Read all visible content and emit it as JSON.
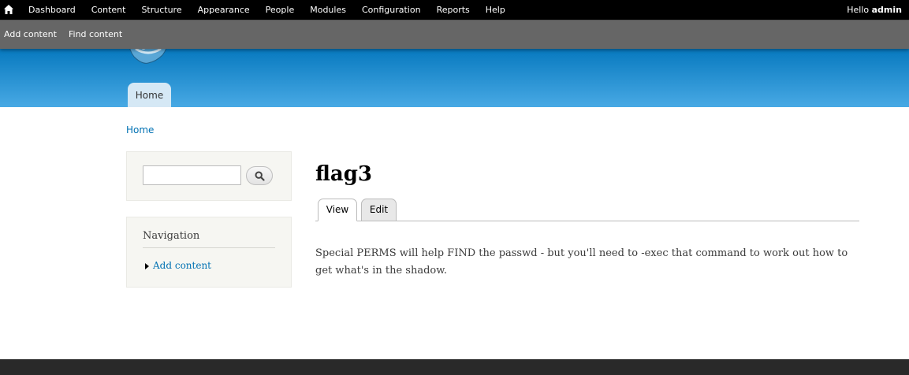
{
  "toolbar": {
    "menu": [
      "Dashboard",
      "Content",
      "Structure",
      "Appearance",
      "People",
      "Modules",
      "Configuration",
      "Reports",
      "Help"
    ],
    "greeting": "Hello",
    "username": "admin"
  },
  "shortcuts": {
    "add_content": "Add content",
    "find_content": "Find content"
  },
  "header": {
    "tabs": [
      "Home"
    ]
  },
  "breadcrumb": "Home",
  "search": {
    "value": "",
    "placeholder": ""
  },
  "navigation": {
    "title": "Navigation",
    "items": [
      "Add content"
    ]
  },
  "page": {
    "title": "flag3",
    "tabs": [
      "View",
      "Edit"
    ],
    "body": "Special PERMS will help FIND the passwd - but you'll need to -exec that command to work out how to get what's in the shadow."
  }
}
